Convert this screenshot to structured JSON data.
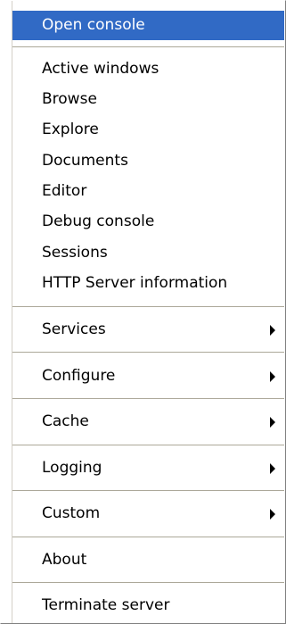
{
  "menu": {
    "highlight_color": "#316ac5",
    "items": [
      {
        "label": "Open console",
        "highlighted": true,
        "submenu": false
      },
      {
        "label": "Active windows",
        "submenu": false
      },
      {
        "label": "Browse",
        "submenu": false
      },
      {
        "label": "Explore",
        "submenu": false
      },
      {
        "label": "Documents",
        "submenu": false
      },
      {
        "label": "Editor",
        "submenu": false
      },
      {
        "label": "Debug console",
        "submenu": false
      },
      {
        "label": "Sessions",
        "submenu": false
      },
      {
        "label": "HTTP Server information",
        "submenu": false
      },
      {
        "label": "Services",
        "submenu": true
      },
      {
        "label": "Configure",
        "submenu": true
      },
      {
        "label": "Cache",
        "submenu": true
      },
      {
        "label": "Logging",
        "submenu": true
      },
      {
        "label": "Custom",
        "submenu": true
      },
      {
        "label": "About",
        "submenu": false
      },
      {
        "label": "Terminate server",
        "submenu": false
      }
    ]
  }
}
